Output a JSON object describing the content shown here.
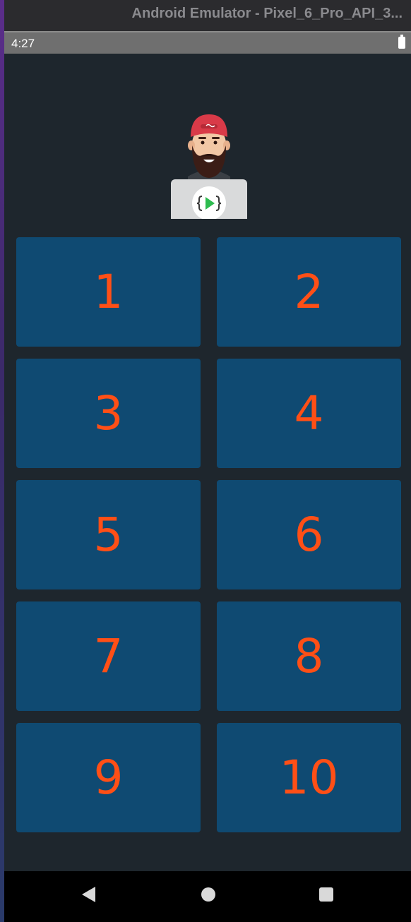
{
  "window": {
    "title": "Android Emulator - Pixel_6_Pro_API_3..."
  },
  "status_bar": {
    "time": "4:27",
    "battery_icon": "battery-full-icon"
  },
  "logo": {
    "icon": "developer-avatar-with-laptop-icon"
  },
  "tiles": [
    {
      "label": "1"
    },
    {
      "label": "2"
    },
    {
      "label": "3"
    },
    {
      "label": "4"
    },
    {
      "label": "5"
    },
    {
      "label": "6"
    },
    {
      "label": "7"
    },
    {
      "label": "8"
    },
    {
      "label": "9"
    },
    {
      "label": "10"
    }
  ],
  "nav_bar": {
    "back_icon": "back-triangle-icon",
    "home_icon": "home-circle-icon",
    "recents_icon": "recents-square-icon"
  },
  "colors": {
    "tile_background": "#0f4a72",
    "tile_text": "#ff4f16",
    "app_background": "#1e262d",
    "status_bar": "#6f6f6f",
    "nav_bar": "#000000"
  }
}
